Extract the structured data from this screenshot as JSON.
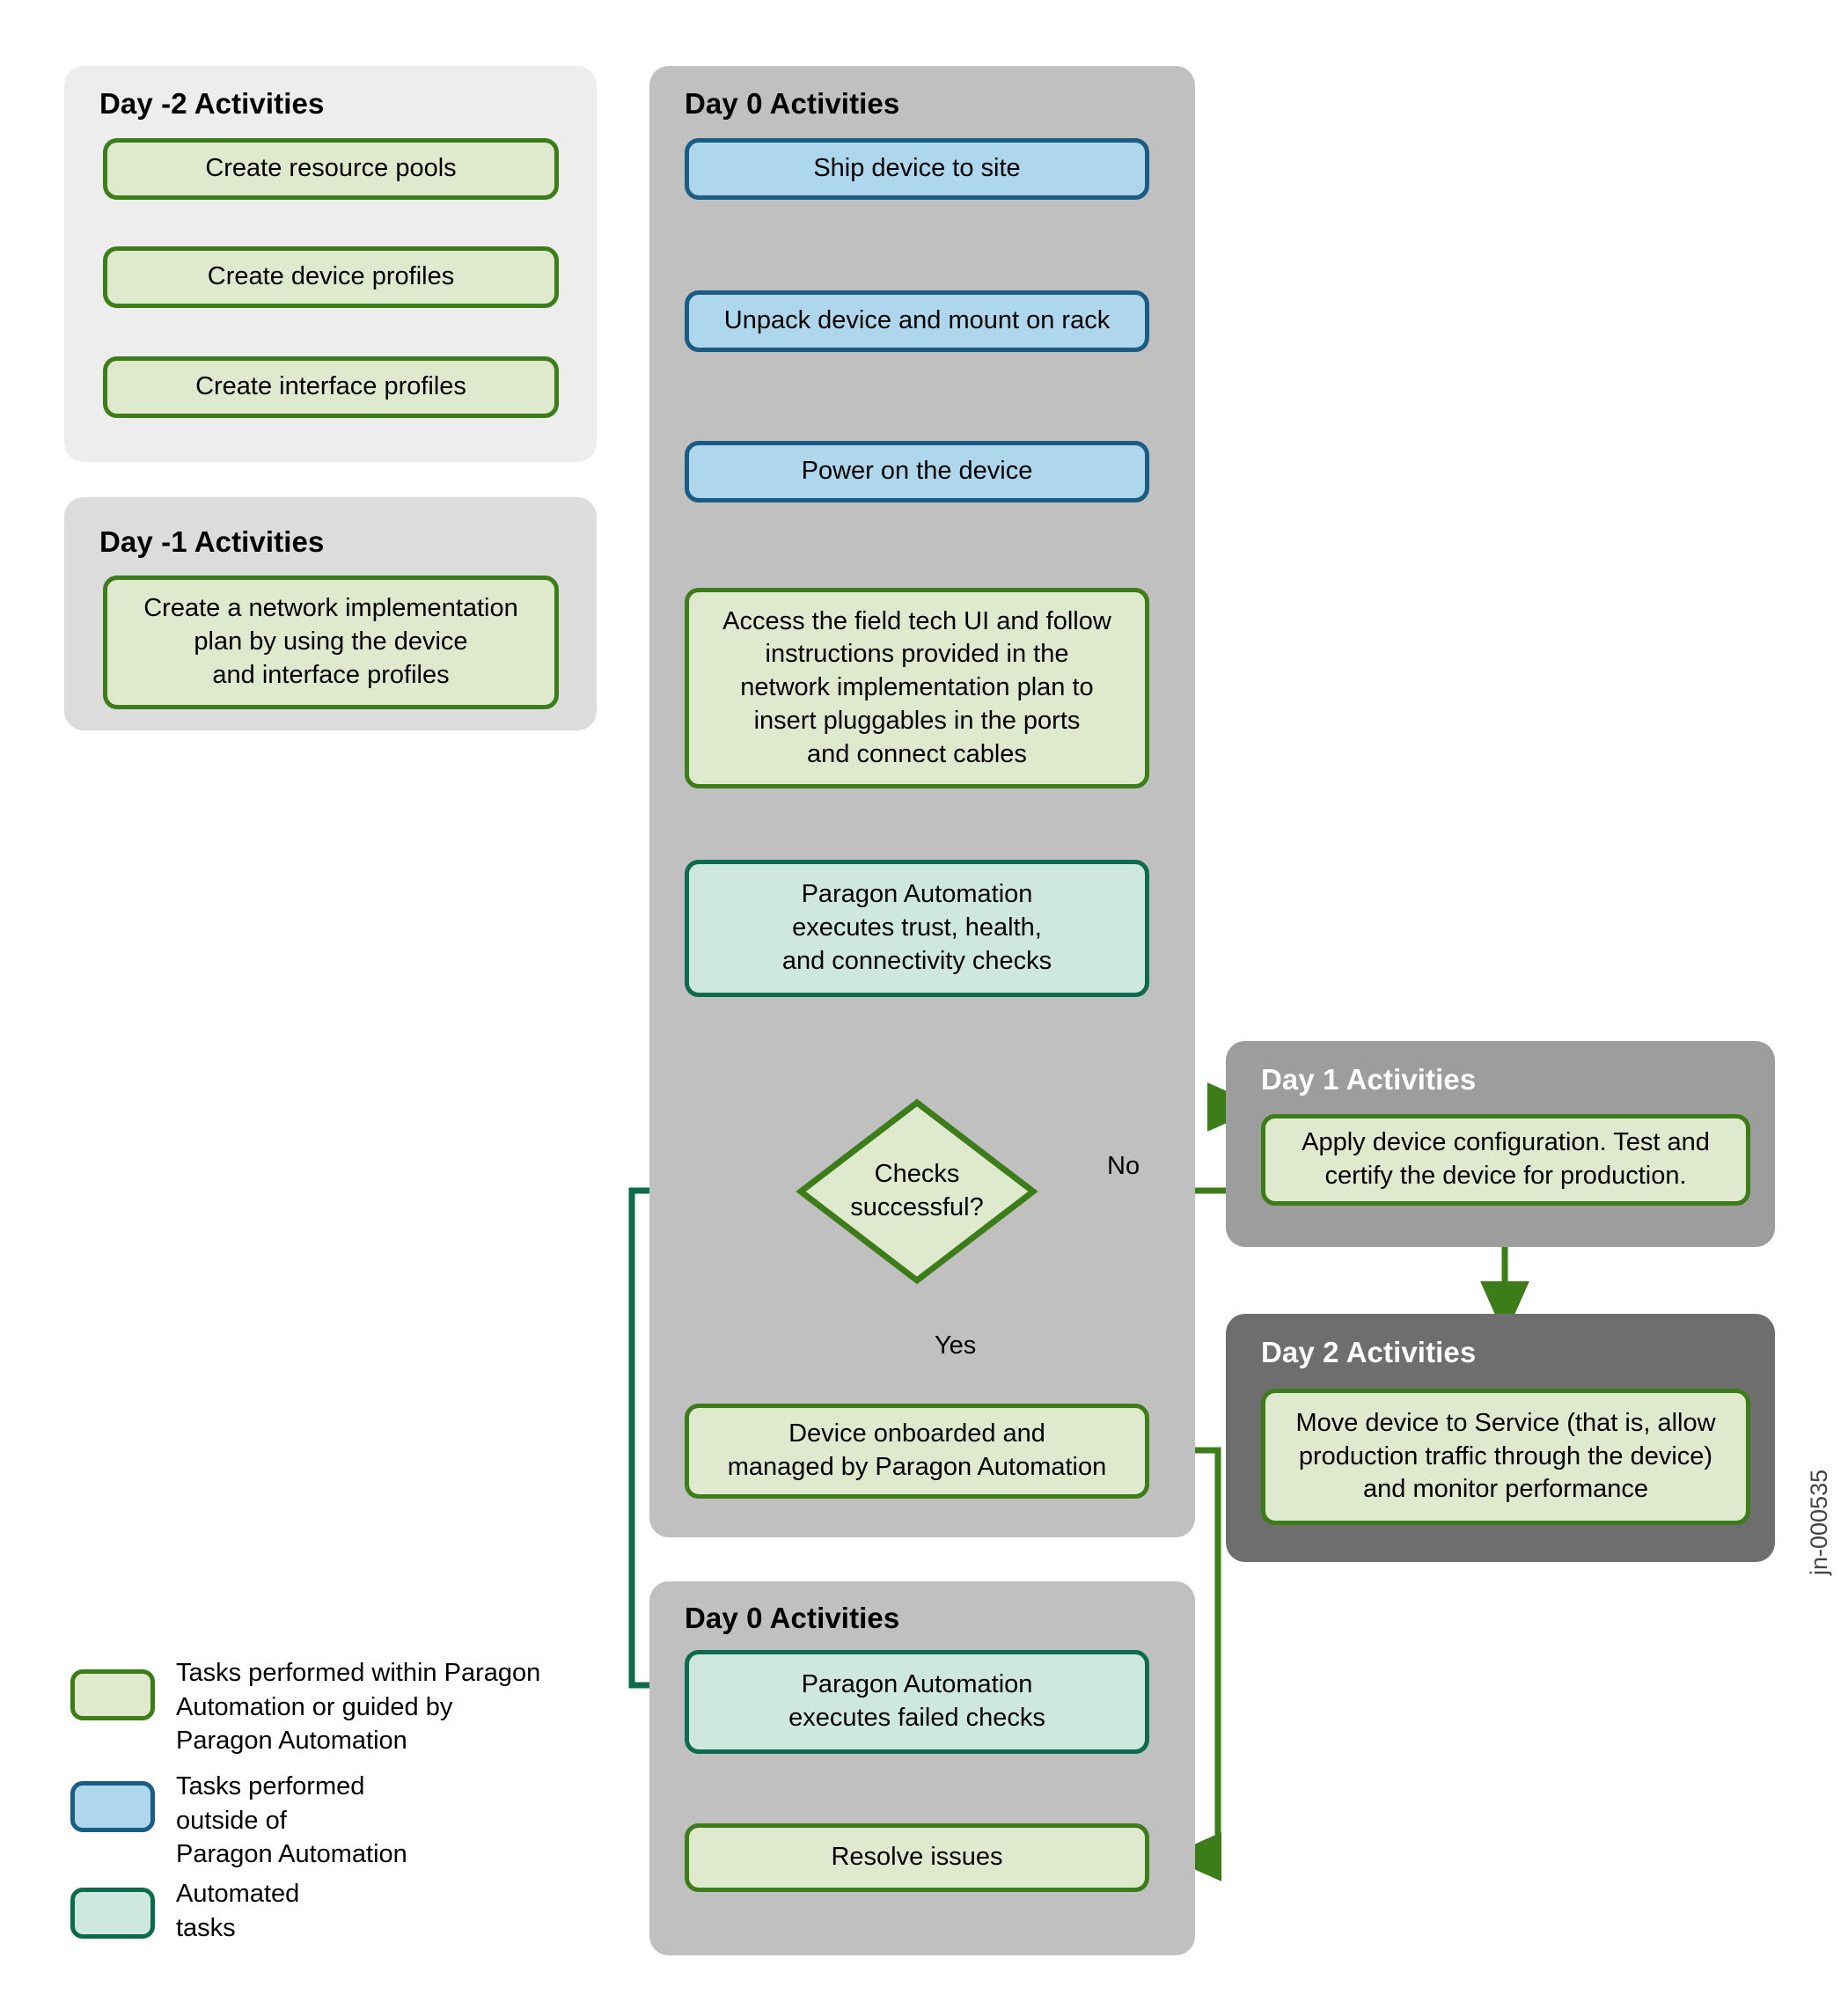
{
  "diagram": {
    "watermark": "jn-000535"
  },
  "panels": {
    "day_minus2": {
      "title": "Day -2 Activities"
    },
    "day_minus1": {
      "title": "Day -1 Activities"
    },
    "day0_top": {
      "title": "Day 0 Activities"
    },
    "day0_bottom": {
      "title": "Day 0 Activities"
    },
    "day1": {
      "title": "Day 1 Activities"
    },
    "day2": {
      "title": "Day 2 Activities"
    }
  },
  "nodes": {
    "create_resource_pools": "Create resource pools",
    "create_device_profiles": "Create device profiles",
    "create_interface_profiles": "Create interface profiles",
    "network_plan": "Create a network implementation\nplan by using the device\nand interface profiles",
    "ship_device": "Ship device to site",
    "unpack_device": "Unpack device and mount on rack",
    "power_on": "Power on the device",
    "field_tech": "Access the field tech UI and follow\ninstructions provided in the\nnetwork implementation plan to\ninsert pluggables in the ports\nand connect cables",
    "checks_run": "Paragon Automation\nexecutes trust, health,\nand connectivity checks",
    "decision": "Checks\nsuccessful?",
    "device_onboarded": "Device onboarded and\nmanaged by Paragon Automation",
    "failed_checks": "Paragon Automation\nexecutes failed checks",
    "resolve_issues": "Resolve issues",
    "apply_config": "Apply device configuration. Test and\ncertify the device for production.",
    "move_to_service": "Move device to Service (that is, allow\nproduction traffic through the device)\nand monitor performance"
  },
  "edge_labels": {
    "no": "No",
    "yes": "Yes"
  },
  "legend": [
    {
      "key": "green",
      "label": "Tasks performed within Paragon\nAutomation or guided by\nParagon Automation"
    },
    {
      "key": "blue",
      "label": "Tasks performed\noutside of\nParagon Automation"
    },
    {
      "key": "teal",
      "label": "Automated\ntasks"
    }
  ],
  "colors": {
    "green_fill": "#dfe9cd",
    "green_border": "#3c7d19",
    "blue_fill": "#aed6ec",
    "blue_border": "#1a5c83",
    "teal_fill": "#cfe8df",
    "teal_border": "#0c6b4c",
    "panel_light": "#ededed",
    "panel_mid_light": "#dcdcdc",
    "panel_gray": "#c0c0c0",
    "panel_gray_dark": "#9d9d9d",
    "panel_darkest": "#6e6e6e",
    "arrow_blue": "#1a5c83",
    "arrow_green": "#3c7d19",
    "arrow_teal": "#0c6b4c"
  }
}
